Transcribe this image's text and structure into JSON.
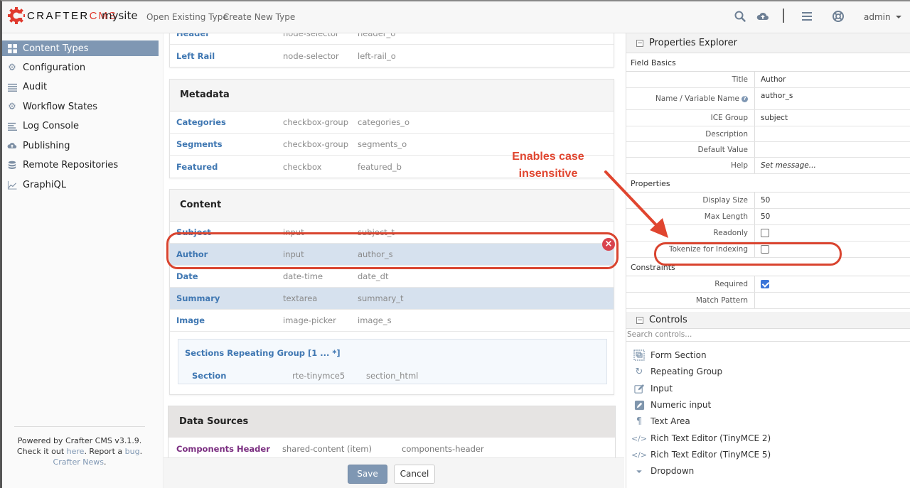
{
  "header": {
    "logo_main": "CRAFTER",
    "logo_accent": "CMS",
    "site": "mysite",
    "links": [
      "Open Existing Type",
      "Create New Type"
    ],
    "icons": [
      "search-icon",
      "cloud-upload-icon",
      "menu-icon",
      "help-lifebuoy-icon"
    ],
    "user": "admin"
  },
  "sidebar": {
    "items": [
      {
        "label": "Content Types",
        "icon": "grid-icon",
        "active": true
      },
      {
        "label": "Configuration",
        "icon": "gear-icon"
      },
      {
        "label": "Audit",
        "icon": "list-icon"
      },
      {
        "label": "Workflow States",
        "icon": "gear-icon"
      },
      {
        "label": "Log Console",
        "icon": "align-left-icon"
      },
      {
        "label": "Publishing",
        "icon": "cloud-upload-icon"
      },
      {
        "label": "Remote Repositories",
        "icon": "database-icon"
      },
      {
        "label": "GraphiQL",
        "icon": "line-chart-icon"
      }
    ],
    "footer": {
      "line1": "Powered by Crafter CMS v3.1.9.",
      "check": "Check it out ",
      "here": "here",
      "report": ". Report a ",
      "bug": "bug",
      "dot": ".",
      "news": "Crafter News",
      "news_dot": "."
    }
  },
  "main": {
    "top_panel": {
      "rows": [
        {
          "title": "Header",
          "type": "node-selector",
          "name": "header_o"
        },
        {
          "title": "Left Rail",
          "type": "node-selector",
          "name": "left-rail_o"
        }
      ]
    },
    "metadata": {
      "title": "Metadata",
      "rows": [
        {
          "title": "Categories",
          "type": "checkbox-group",
          "name": "categories_o"
        },
        {
          "title": "Segments",
          "type": "checkbox-group",
          "name": "segments_o"
        },
        {
          "title": "Featured",
          "type": "checkbox",
          "name": "featured_b"
        }
      ]
    },
    "content": {
      "title": "Content",
      "rows": [
        {
          "title": "Subject",
          "type": "input",
          "name": "subject_t"
        },
        {
          "title": "Author",
          "type": "input",
          "name": "author_s",
          "selected": true
        },
        {
          "title": "Date",
          "type": "date-time",
          "name": "date_dt"
        },
        {
          "title": "Summary",
          "type": "textarea",
          "name": "summary_t",
          "highlight": true
        },
        {
          "title": "Image",
          "type": "image-picker",
          "name": "image_s"
        }
      ],
      "repeating_group": {
        "title": "Sections Repeating Group [1 ... *]",
        "row": {
          "title": "Section",
          "type": "rte-tinymce5",
          "name": "section_html"
        }
      }
    },
    "data_sources": {
      "title": "Data Sources",
      "rows": [
        {
          "title": "Components Header",
          "type": "shared-content (item)",
          "name": "components-header"
        }
      ]
    },
    "buttons": {
      "save": "Save",
      "cancel": "Cancel"
    },
    "delete_icon": "×"
  },
  "annotation": {
    "text_line1": "Enables case",
    "text_line2": "insensitive",
    "color": "#e0452f"
  },
  "properties": {
    "title": "Properties Explorer",
    "field_basics": {
      "label": "Field Basics",
      "rows": [
        {
          "label": "Title",
          "value": "Author"
        },
        {
          "label": "Name / Variable Name",
          "value": "author_s",
          "help": true
        },
        {
          "label": "ICE Group",
          "value": "subject"
        },
        {
          "label": "Description",
          "value": ""
        },
        {
          "label": "Default Value",
          "value": ""
        },
        {
          "label": "Help",
          "value": "Set message..."
        }
      ]
    },
    "properties_section": {
      "label": "Properties",
      "rows": [
        {
          "label": "Display Size",
          "value": "50"
        },
        {
          "label": "Max Length",
          "value": "50"
        },
        {
          "label": "Readonly",
          "checked": false
        },
        {
          "label": "Tokenize for Indexing",
          "checked": false
        }
      ]
    },
    "constraints": {
      "label": "Constraints",
      "rows": [
        {
          "label": "Required",
          "checked": true
        },
        {
          "label": "Match Pattern",
          "value": ""
        }
      ]
    }
  },
  "controls": {
    "title": "Controls",
    "search_placeholder": "Search controls...",
    "items": [
      {
        "label": "Form Section",
        "icon": "form-section-icon"
      },
      {
        "label": "Repeating Group",
        "icon": "repeat-icon"
      },
      {
        "label": "Input",
        "icon": "edit-icon"
      },
      {
        "label": "Numeric input",
        "icon": "edit-filled-icon"
      },
      {
        "label": "Text Area",
        "icon": "paragraph-icon"
      },
      {
        "label": "Rich Text Editor (TinyMCE 2)",
        "icon": "code-icon"
      },
      {
        "label": "Rich Text Editor (TinyMCE 5)",
        "icon": "code-icon"
      },
      {
        "label": "Dropdown",
        "icon": "caret-down-icon"
      }
    ]
  }
}
